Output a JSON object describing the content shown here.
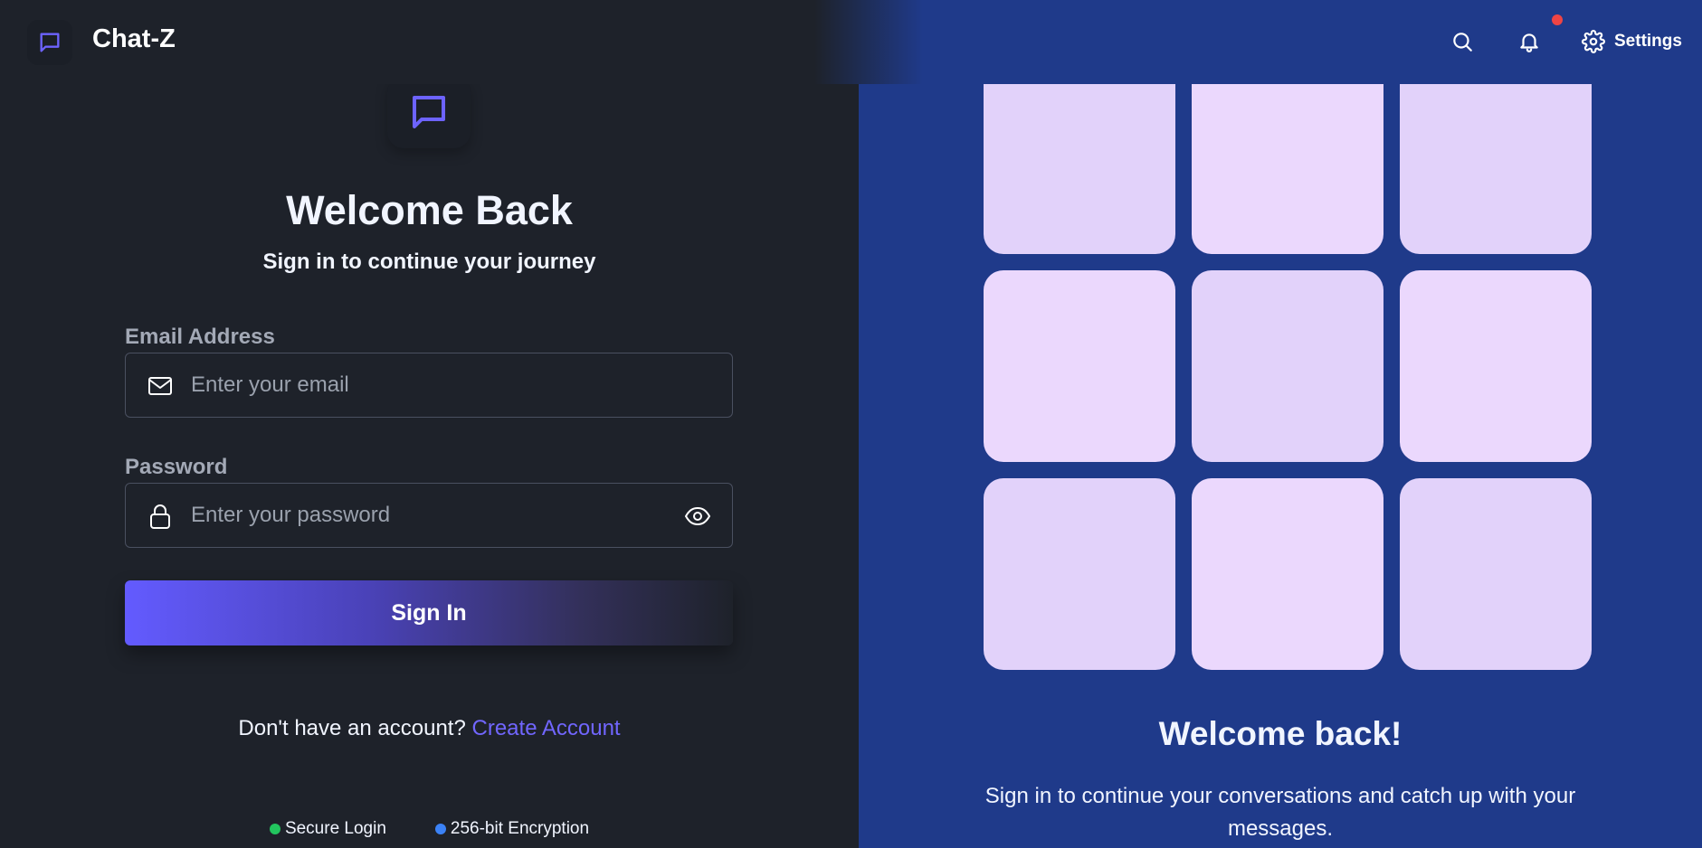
{
  "header": {
    "brand": "Chat-Z",
    "settings_label": "Settings",
    "icons": [
      "chat-icon",
      "search-icon",
      "bell-icon",
      "gear-icon"
    ],
    "notification_dot_color": "#ef4444"
  },
  "login": {
    "title": "Welcome Back",
    "subtitle": "Sign in to continue your journey",
    "email": {
      "label": "Email Address",
      "placeholder": "Enter your email",
      "value": ""
    },
    "password": {
      "label": "Password",
      "placeholder": "Enter your password",
      "value": ""
    },
    "submit_label": "Sign In",
    "signup_prompt": "Don't have an account?",
    "signup_link": "Create Account",
    "badges": [
      {
        "label": "Secure Login",
        "color": "#22c55e"
      },
      {
        "label": "256-bit Encryption",
        "color": "#3b82f6"
      }
    ]
  },
  "promo": {
    "title": "Welcome back!",
    "text": "Sign in to continue your conversations and catch up with your messages.",
    "tile_colors": [
      "#e2d2fa",
      "#ebd8fd",
      "#e2d2fa",
      "#ebd8fd",
      "#e2d2fa",
      "#ebd8fd",
      "#e2d2fa",
      "#ebd8fd",
      "#e2d2fa"
    ]
  },
  "colors": {
    "accent": "#635bff",
    "left_bg": "#1e222a",
    "right_bg": "#1f3a8a"
  }
}
